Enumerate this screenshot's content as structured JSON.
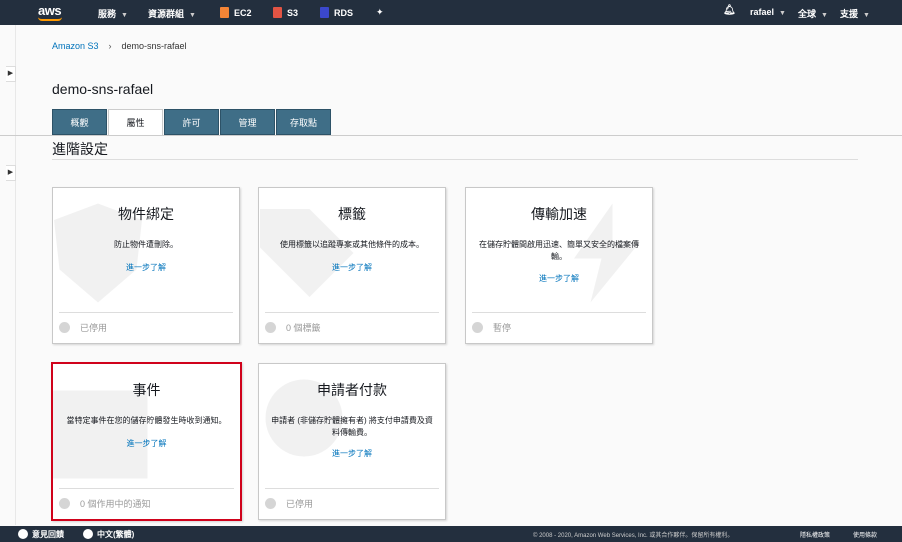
{
  "topnav": {
    "logo": "aws",
    "services": "服務",
    "resource_groups": "資源群組",
    "ec2": "EC2",
    "s3": "S3",
    "rds": "RDS",
    "user": "rafael",
    "region": "全球",
    "support": "支援",
    "colors": {
      "ec2": "#f58536",
      "s3": "#e25444",
      "rds": "#3b48cc"
    }
  },
  "breadcrumb": {
    "root": "Amazon S3",
    "separator": "›",
    "current": "demo-sns-rafael"
  },
  "page_title": "demo-sns-rafael",
  "tabs": [
    "概觀",
    "屬性",
    "許可",
    "管理",
    "存取點"
  ],
  "active_tab": "屬性",
  "section_title": "進階設定",
  "cards": [
    {
      "title": "物件綁定",
      "desc": "防止物件遭刪除。",
      "link": "進一步了解",
      "status": "已停用"
    },
    {
      "title": "標籤",
      "desc": "使用標籤以追蹤專案或其他條件的成本。",
      "link": "進一步了解",
      "status": "0 個標籤"
    },
    {
      "title": "傳輸加速",
      "desc": "在儲存貯體間啟用迅速、簡單又安全的檔案傳輸。",
      "link": "進一步了解",
      "status": "暫停"
    },
    {
      "title": "事件",
      "desc": "當特定事件在您的儲存貯體發生時收到通知。",
      "link": "進一步了解",
      "status": "0 個作用中的通知"
    },
    {
      "title": "申請者付款",
      "desc": "申請者 (非儲存貯體擁有者) 將支付申請費及資料傳輸費。",
      "link": "進一步了解",
      "status": "已停用"
    }
  ],
  "footer": {
    "feedback": "意見回饋",
    "language": "中文(繁體)",
    "copyright": "© 2008 - 2020, Amazon Web Services, Inc. 或其合作夥伴。保留所有權利。",
    "privacy": "隱私權政策",
    "terms": "使用條款"
  }
}
